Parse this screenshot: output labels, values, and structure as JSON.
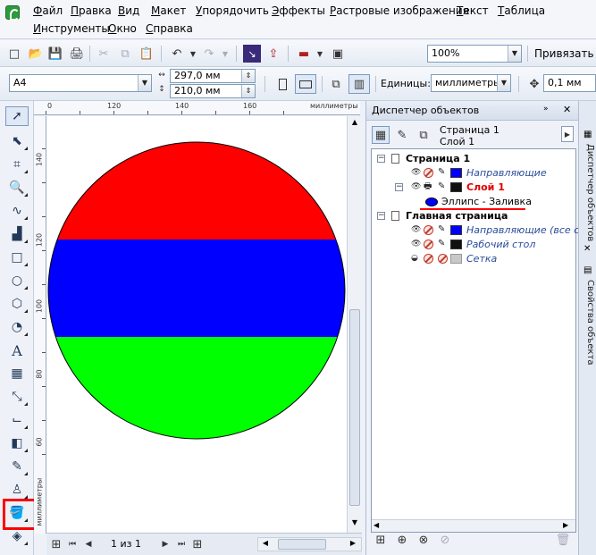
{
  "menu": [
    "Файл",
    "Правка",
    "Вид",
    "Макет",
    "Упорядочить",
    "Эффекты",
    "Растровые изображения",
    "Текст",
    "Таблица",
    "Инструменты",
    "Окно",
    "Справка"
  ],
  "toolbar": {
    "zoom": "100%",
    "snap_label": "Привязать к"
  },
  "property_bar": {
    "paper_size": "A4",
    "width": "297,0 мм",
    "height": "210,0 мм",
    "units_label": "Единицы:",
    "units_value": "миллиметры",
    "nudge": "0,1 мм"
  },
  "ruler": {
    "top_numbers": [
      "0",
      "120",
      "140",
      "160"
    ],
    "top_unit": "миллиметры",
    "left_numbers": [
      "140",
      "120",
      "100",
      "80",
      "60"
    ],
    "left_unit": "миллиметры"
  },
  "status": {
    "page_nav": "1 из 1"
  },
  "docker": {
    "title": "Диспетчер объектов",
    "header_page": "Страница 1",
    "header_layer": "Слой 1",
    "tree": {
      "page1": "Страница 1",
      "guides": "Направляющие",
      "layer1": "Слой 1",
      "ellipse": "Эллипс - Заливка",
      "master": "Главная страница",
      "master_guides": "Направляющие (все стр",
      "desktop": "Рабочий стол",
      "grid": "Сетка"
    }
  },
  "side_tabs": {
    "objects": "Диспетчер объектов",
    "properties": "Свойства объекта"
  },
  "colors": {
    "red": "#ff0000",
    "blue": "#0000ff",
    "green": "#00ff00",
    "layer_text": "#e00000",
    "italic_blue": "#2a4c9a"
  }
}
